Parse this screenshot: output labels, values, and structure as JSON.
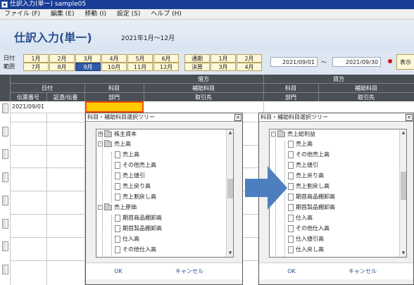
{
  "window": {
    "title": "仕訳入力(単一) sample05"
  },
  "menu": [
    "ファイル (F)",
    "編集 (E)",
    "移動 (I)",
    "設定 (S)",
    "ヘルプ (H)"
  ],
  "header": {
    "title": "仕訳入力(単一)",
    "period": "2021年1月～12月"
  },
  "date_filter": {
    "label_top": "日付",
    "label_bottom": "範囲",
    "months_row1": [
      "1月",
      "2月",
      "3月",
      "4月",
      "5月",
      "6月"
    ],
    "months_row2": [
      "7月",
      "8月",
      "9月",
      "10月",
      "11月",
      "12月"
    ],
    "selected_month": "9月",
    "extra_row1": [
      "通期",
      "1月",
      "2月"
    ],
    "extra_row2": [
      "決算",
      "3月",
      "4月"
    ],
    "from": "2021/09/01",
    "tilde": "～",
    "to": "2021/09/30",
    "show_button": "表示"
  },
  "table": {
    "debit": "借方",
    "credit": "貸方",
    "date": "日付",
    "voucher_no": "伝票番号",
    "evidence": "証憑/伝番",
    "account": "科目",
    "sub_account": "補助科目",
    "department": "部門",
    "partner": "取引先",
    "first_row_date": "2021/09/01"
  },
  "dialog_left": {
    "title": "科目・補助科目選択ツリー",
    "close": "×",
    "items": [
      {
        "label": "株主資本",
        "type": "folder",
        "expander": "+"
      },
      {
        "label": "売上高",
        "type": "folder",
        "expander": "-"
      },
      {
        "label": "売上高",
        "type": "doc"
      },
      {
        "label": "その他売上高",
        "type": "doc"
      },
      {
        "label": "売上値引",
        "type": "doc"
      },
      {
        "label": "売上戻り高",
        "type": "doc"
      },
      {
        "label": "売上割戻し高",
        "type": "doc"
      },
      {
        "label": "売上原価",
        "type": "folder",
        "expander": "-"
      },
      {
        "label": "期首商品棚卸高",
        "type": "doc"
      },
      {
        "label": "期首製品棚卸高",
        "type": "doc"
      },
      {
        "label": "仕入高",
        "type": "doc"
      },
      {
        "label": "その他仕入高",
        "type": "doc"
      }
    ],
    "ok": "OK",
    "cancel": "キャンセル"
  },
  "dialog_right": {
    "title": "科目・補助科目選択ツリー",
    "close": "×",
    "items": [
      {
        "label": "売上総利益",
        "type": "folder",
        "expander": "-"
      },
      {
        "label": "売上高",
        "type": "doc"
      },
      {
        "label": "その他売上高",
        "type": "doc"
      },
      {
        "label": "売上値引",
        "type": "doc"
      },
      {
        "label": "売上戻り高",
        "type": "doc"
      },
      {
        "label": "売上割戻し高",
        "type": "doc"
      },
      {
        "label": "期首商品棚卸高",
        "type": "doc"
      },
      {
        "label": "期首製品棚卸高",
        "type": "doc"
      },
      {
        "label": "仕入高",
        "type": "doc"
      },
      {
        "label": "その他仕入高",
        "type": "doc"
      },
      {
        "label": "仕入値引高",
        "type": "doc"
      },
      {
        "label": "仕入戻し高",
        "type": "doc"
      }
    ],
    "ok": "OK",
    "cancel": "キャンセル"
  },
  "colors": {
    "accent": "#2e5aa8",
    "arrow": "#4d7fc0",
    "highlight": "#ffcc00"
  }
}
